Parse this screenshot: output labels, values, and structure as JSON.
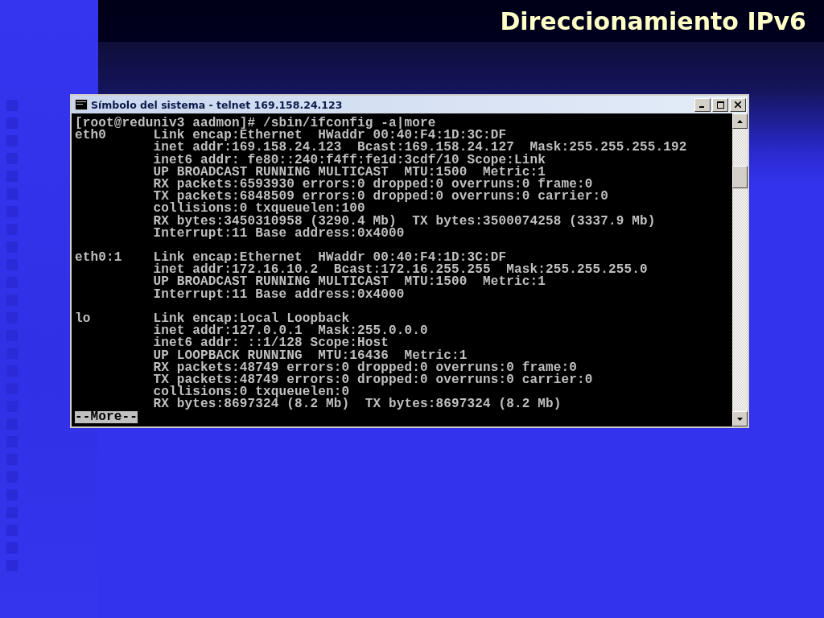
{
  "slide": {
    "title": "Direccionamiento IPv6"
  },
  "window": {
    "title": "Símbolo del sistema - telnet 169.158.24.123"
  },
  "terminal": {
    "prompt_line": "[root@reduniv3 aadmon]# /sbin/ifconfig -a|more",
    "blocks": [
      {
        "lines": [
          "eth0      Link encap:Ethernet  HWaddr 00:40:F4:1D:3C:DF",
          "          inet addr:169.158.24.123  Bcast:169.158.24.127  Mask:255.255.255.192",
          "          inet6 addr: fe80::240:f4ff:fe1d:3cdf/10 Scope:Link",
          "          UP BROADCAST RUNNING MULTICAST  MTU:1500  Metric:1",
          "          RX packets:6593930 errors:0 dropped:0 overruns:0 frame:0",
          "          TX packets:6848509 errors:0 dropped:0 overruns:0 carrier:0",
          "          collisions:0 txqueuelen:100",
          "          RX bytes:3450310958 (3290.4 Mb)  TX bytes:3500074258 (3337.9 Mb)",
          "          Interrupt:11 Base address:0x4000"
        ]
      },
      {
        "lines": [
          "eth0:1    Link encap:Ethernet  HWaddr 00:40:F4:1D:3C:DF",
          "          inet addr:172.16.10.2  Bcast:172.16.255.255  Mask:255.255.255.0",
          "          UP BROADCAST RUNNING MULTICAST  MTU:1500  Metric:1",
          "          Interrupt:11 Base address:0x4000"
        ]
      },
      {
        "lines": [
          "lo        Link encap:Local Loopback",
          "          inet addr:127.0.0.1  Mask:255.0.0.0",
          "          inet6 addr: ::1/128 Scope:Host",
          "          UP LOOPBACK RUNNING  MTU:16436  Metric:1",
          "          RX packets:48749 errors:0 dropped:0 overruns:0 frame:0",
          "          TX packets:48749 errors:0 dropped:0 overruns:0 carrier:0",
          "          collisions:0 txqueuelen:0",
          "          RX bytes:8697324 (8.2 Mb)  TX bytes:8697324 (8.2 Mb)"
        ]
      }
    ],
    "pager": "--More--"
  }
}
